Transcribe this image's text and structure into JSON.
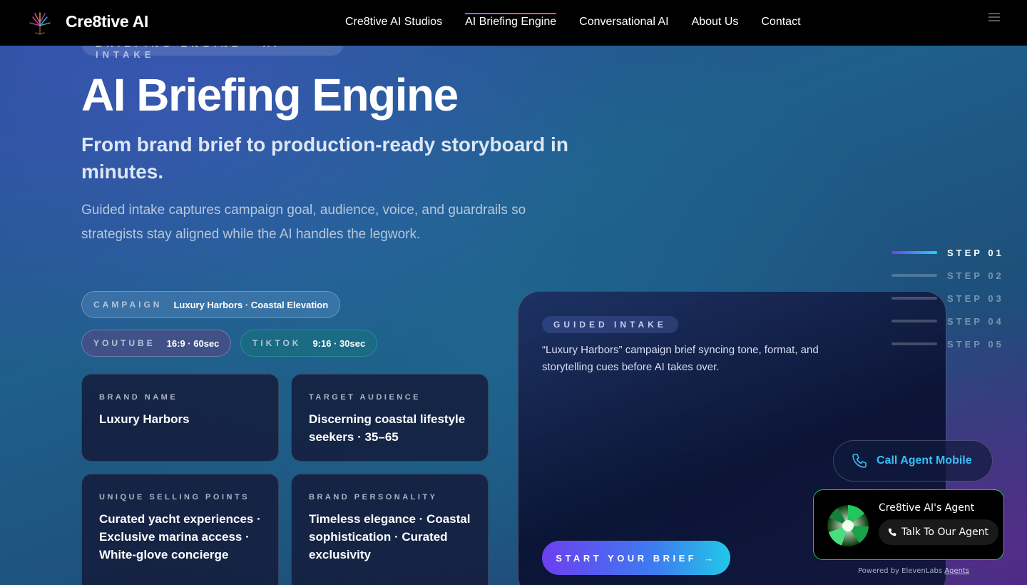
{
  "nav": {
    "brand": "Cre8tive AI",
    "links": [
      {
        "label": "Cre8tive AI Studios"
      },
      {
        "label": "AI Briefing Engine",
        "active": true
      },
      {
        "label": "Conversational AI"
      },
      {
        "label": "About Us"
      },
      {
        "label": "Contact"
      }
    ]
  },
  "hero": {
    "eyebrow": "BRIEFING ENGINE · AI INTAKE",
    "title": "AI Briefing Engine",
    "subtitle": "From brand brief to production-ready storyboard in minutes.",
    "description": "Guided intake captures campaign goal, audience, voice, and guardrails so strategists stay aligned while the AI handles the legwork."
  },
  "chips": {
    "campaign": {
      "key": "CAMPAIGN",
      "value": "Luxury Harbors · Coastal Elevation"
    },
    "youtube": {
      "key": "YOUTUBE",
      "value": "16:9 · 60sec"
    },
    "tiktok": {
      "key": "TIKTOK",
      "value": "9:16 · 30sec"
    }
  },
  "cards": [
    {
      "key": "BRAND NAME",
      "value": "Luxury Harbors"
    },
    {
      "key": "TARGET AUDIENCE",
      "value": "Discerning coastal lifestyle seekers · 35–65"
    },
    {
      "key": "UNIQUE SELLING POINTS",
      "value": "Curated yacht experiences · Exclusive marina access · White-glove concierge"
    },
    {
      "key": "BRAND PERSONALITY",
      "value": "Timeless elegance · Coastal sophistication · Curated exclusivity"
    }
  ],
  "panel": {
    "tag": "GUIDED INTAKE",
    "text": "“Luxury Harbors” campaign brief syncing tone, format, and storytelling cues before AI takes over.",
    "cta": "START YOUR BRIEF",
    "cta_arrow": "→"
  },
  "steps": [
    {
      "label": "STEP 01",
      "active": true
    },
    {
      "label": "STEP 02"
    },
    {
      "label": "STEP 03"
    },
    {
      "label": "STEP 04"
    },
    {
      "label": "STEP 05"
    }
  ],
  "call": {
    "label": "Call Agent Mobile"
  },
  "agent": {
    "name": "Cre8tive AI's Agent",
    "talk": "Talk To Our Agent",
    "powered_prefix": "Powered by ElevenLabs",
    "powered_link": "Agents"
  },
  "colors": {
    "accent_cyan": "#38bdf8",
    "agent_border": "#22c55e",
    "nav_bg": "#000000"
  },
  "icons": {
    "logo": "tree-logo-icon",
    "menu": "menu-icon",
    "phone": "phone-icon",
    "arrow": "arrow-right-icon"
  }
}
